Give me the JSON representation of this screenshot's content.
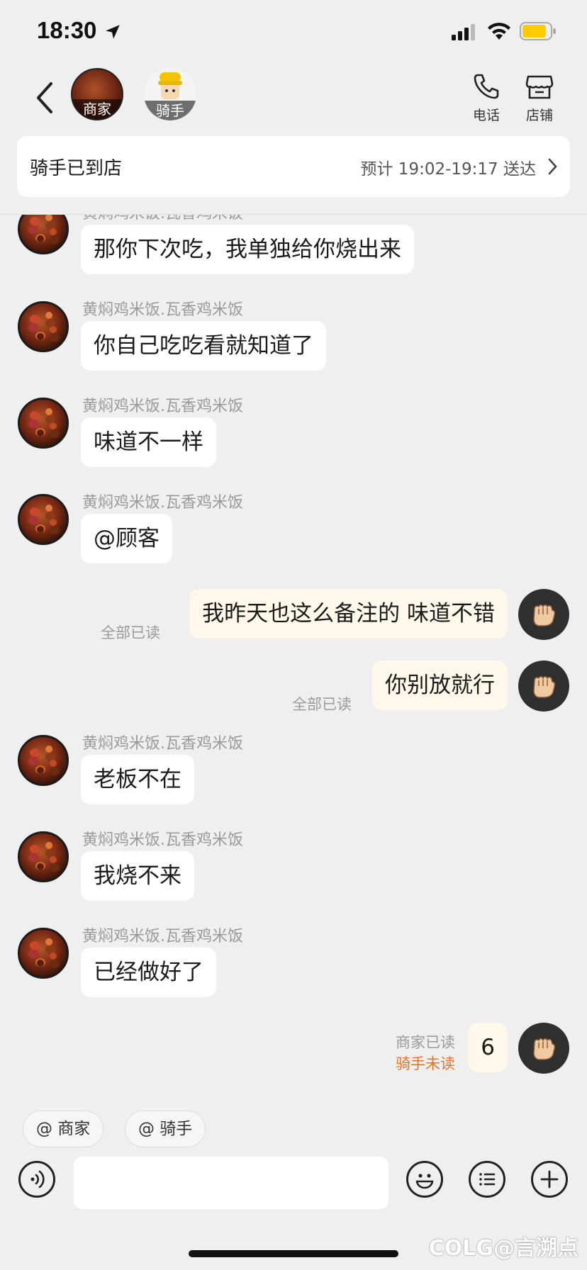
{
  "status_bar": {
    "time": "18:30"
  },
  "header": {
    "merchant_tag": "商家",
    "rider_tag": "骑手",
    "phone_label": "电话",
    "shop_label": "店铺"
  },
  "delivery": {
    "status": "骑手已到店",
    "eta": "预计 19:02-19:17 送达"
  },
  "messages": [
    {
      "sender": "黄焖鸡米饭.瓦香鸡米饭",
      "text": "那你下次吃，我单独给你烧出来"
    },
    {
      "sender": "黄焖鸡米饭.瓦香鸡米饭",
      "text": "你自己吃吃看就知道了"
    },
    {
      "sender": "黄焖鸡米饭.瓦香鸡米饭",
      "text": "味道不一样"
    },
    {
      "sender": "黄焖鸡米饭.瓦香鸡米饭",
      "text": "@顾客"
    },
    {
      "text": "我昨天也这么备注的 味道不错",
      "read": "全部已读"
    },
    {
      "text": "你别放就行",
      "read": "全部已读"
    },
    {
      "sender": "黄焖鸡米饭.瓦香鸡米饭",
      "text": "老板不在"
    },
    {
      "sender": "黄焖鸡米饭.瓦香鸡米饭",
      "text": "我烧不来"
    },
    {
      "sender": "黄焖鸡米饭.瓦香鸡米饭",
      "text": "已经做好了"
    },
    {
      "text": "6",
      "read_merchant": "商家已读",
      "read_rider": "骑手未读"
    }
  ],
  "mentions": {
    "merchant": "@ 商家",
    "rider": "@ 骑手"
  },
  "watermark": "COLG@言溯点",
  "colors": {
    "unread": "#e8742a",
    "outgoing_bubble": "#fdf8e9",
    "background": "#efefef",
    "battery": "#ffcc00"
  },
  "icons": [
    "location-arrow-icon",
    "signal-icon",
    "wifi-icon",
    "battery-icon",
    "back-chevron-icon",
    "phone-icon",
    "shop-icon",
    "fist-icon",
    "voice-icon",
    "emoji-icon",
    "menu-icon",
    "add-icon"
  ]
}
